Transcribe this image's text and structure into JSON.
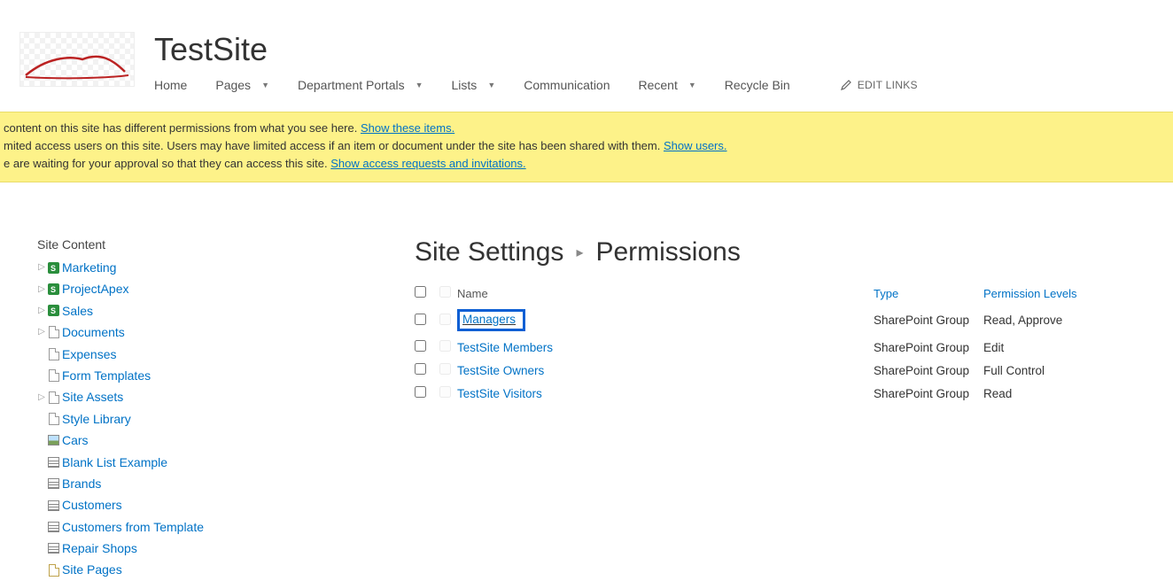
{
  "site": {
    "title": "TestSite"
  },
  "nav": {
    "items": [
      {
        "label": "Home",
        "dropdown": false
      },
      {
        "label": "Pages",
        "dropdown": true
      },
      {
        "label": "Department Portals",
        "dropdown": true
      },
      {
        "label": "Lists",
        "dropdown": true
      },
      {
        "label": "Communication",
        "dropdown": false
      },
      {
        "label": "Recent",
        "dropdown": true
      },
      {
        "label": "Recycle Bin",
        "dropdown": false
      }
    ],
    "edit_links": "EDIT LINKS"
  },
  "notifications": {
    "line1_prefix": " content on this site has different permissions from what you see here.  ",
    "line1_link": "Show these items.",
    "line2_prefix": "mited access users on this site. Users may have limited access if an item or document under the site has been shared with them. ",
    "line2_link": "Show users.",
    "line3_prefix": "e are waiting for your approval so that they can access this site. ",
    "line3_link": "Show access requests and invitations."
  },
  "sidebar": {
    "title": "Site Content",
    "items": [
      {
        "label": "Marketing",
        "icon": "site",
        "expandable": true
      },
      {
        "label": "ProjectApex",
        "icon": "site",
        "expandable": true
      },
      {
        "label": "Sales",
        "icon": "site",
        "expandable": true
      },
      {
        "label": "Documents",
        "icon": "doc",
        "expandable": true
      },
      {
        "label": "Expenses",
        "icon": "doc",
        "expandable": false
      },
      {
        "label": "Form Templates",
        "icon": "doc",
        "expandable": false
      },
      {
        "label": "Site Assets",
        "icon": "doc",
        "expandable": true
      },
      {
        "label": "Style Library",
        "icon": "doc",
        "expandable": false
      },
      {
        "label": "Cars",
        "icon": "img",
        "expandable": false
      },
      {
        "label": "Blank List Example",
        "icon": "list",
        "expandable": false
      },
      {
        "label": "Brands",
        "icon": "list",
        "expandable": false
      },
      {
        "label": "Customers",
        "icon": "list",
        "expandable": false
      },
      {
        "label": "Customers from Template",
        "icon": "list",
        "expandable": false
      },
      {
        "label": "Repair Shops",
        "icon": "list",
        "expandable": false
      },
      {
        "label": "Site Pages",
        "icon": "page",
        "expandable": false
      }
    ]
  },
  "breadcrumb": {
    "parent": "Site Settings",
    "current": "Permissions"
  },
  "perm_columns": {
    "name": "Name",
    "type": "Type",
    "levels": "Permission Levels"
  },
  "permissions": [
    {
      "name": "Managers",
      "type": "SharePoint Group",
      "levels": "Read, Approve",
      "highlight": true
    },
    {
      "name": "TestSite Members",
      "type": "SharePoint Group",
      "levels": "Edit"
    },
    {
      "name": "TestSite Owners",
      "type": "SharePoint Group",
      "levels": "Full Control"
    },
    {
      "name": "TestSite Visitors",
      "type": "SharePoint Group",
      "levels": "Read"
    }
  ]
}
